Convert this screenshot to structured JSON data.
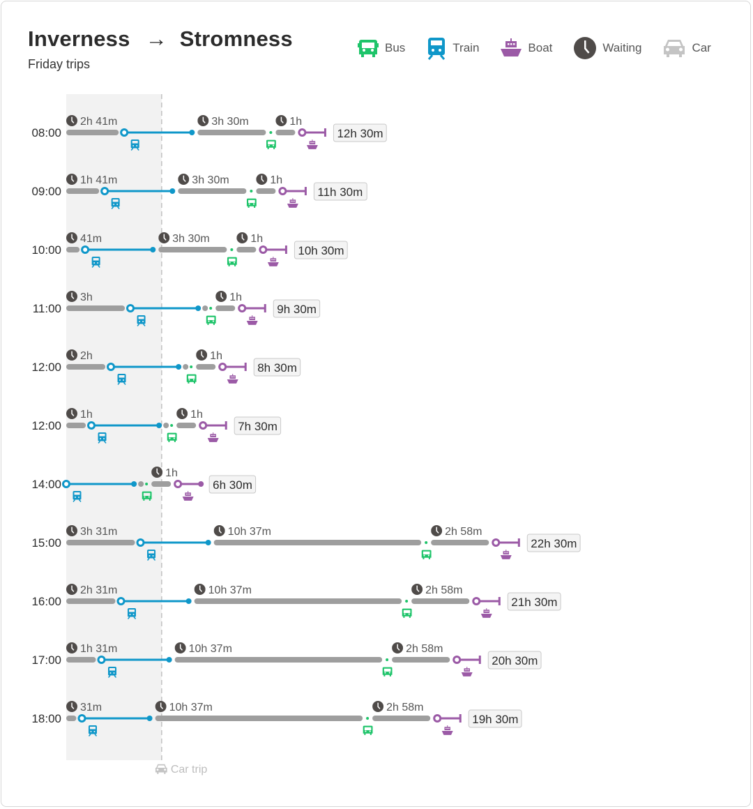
{
  "header": {
    "origin": "Inverness",
    "arrow": "→",
    "destination": "Stromness",
    "subtitle": "Friday trips"
  },
  "legend": [
    {
      "key": "bus",
      "label": "Bus",
      "icon": "bus-icon",
      "color": "#1ec46a"
    },
    {
      "key": "train",
      "label": "Train",
      "icon": "train-icon",
      "color": "#0f97c9"
    },
    {
      "key": "boat",
      "label": "Boat",
      "icon": "boat-icon",
      "color": "#9b5aa6"
    },
    {
      "key": "waiting",
      "label": "Waiting",
      "icon": "clock-icon",
      "color": "#4f4b49"
    },
    {
      "key": "car",
      "label": "Car",
      "icon": "car-icon",
      "color": "#c4c4c4"
    }
  ],
  "colors": {
    "wait": "#9e9e9e",
    "train": "#0f97c9",
    "bus": "#1ec46a",
    "boat": "#9b5aa6",
    "clock": "#4f4b49",
    "car_zone": "#f2f2f2",
    "car_line": "#c4c4c4"
  },
  "chart_data": {
    "type": "timeline",
    "title": "Inverness → Stromness",
    "subtitle": "Friday trips",
    "units": "minutes from departure",
    "car_trip": {
      "label": "Car trip",
      "duration_min": 293
    },
    "rows": [
      {
        "departure": "08:00",
        "total": "12h 30m",
        "segments": [
          {
            "type": "wait",
            "min": 161,
            "label": "2h 41m"
          },
          {
            "type": "train",
            "min": 208
          },
          {
            "type": "wait",
            "min": 210,
            "label": "3h 30m"
          },
          {
            "type": "bus"
          },
          {
            "type": "wait",
            "min": 60,
            "label": "1h"
          },
          {
            "type": "boat",
            "min": 75,
            "end": "bar"
          }
        ]
      },
      {
        "departure": "09:00",
        "total": "11h 30m",
        "segments": [
          {
            "type": "wait",
            "min": 101,
            "label": "1h 41m"
          },
          {
            "type": "train",
            "min": 208
          },
          {
            "type": "wait",
            "min": 210,
            "label": "3h 30m"
          },
          {
            "type": "bus"
          },
          {
            "type": "wait",
            "min": 60,
            "label": "1h"
          },
          {
            "type": "boat",
            "min": 75,
            "end": "bar"
          }
        ]
      },
      {
        "departure": "10:00",
        "total": "10h 30m",
        "segments": [
          {
            "type": "wait",
            "min": 41,
            "label": "41m"
          },
          {
            "type": "train",
            "min": 208
          },
          {
            "type": "wait",
            "min": 210,
            "label": "3h 30m"
          },
          {
            "type": "bus"
          },
          {
            "type": "wait",
            "min": 60,
            "label": "1h"
          },
          {
            "type": "boat",
            "min": 75,
            "end": "bar"
          }
        ]
      },
      {
        "departure": "11:00",
        "total": "9h 30m",
        "segments": [
          {
            "type": "wait",
            "min": 180,
            "label": "3h"
          },
          {
            "type": "train",
            "min": 208
          },
          {
            "type": "shortwait"
          },
          {
            "type": "bus"
          },
          {
            "type": "wait",
            "min": 60,
            "label": "1h"
          },
          {
            "type": "boat",
            "min": 75,
            "end": "bar"
          }
        ]
      },
      {
        "departure": "12:00",
        "total": "8h 30m",
        "segments": [
          {
            "type": "wait",
            "min": 120,
            "label": "2h"
          },
          {
            "type": "train",
            "min": 208
          },
          {
            "type": "shortwait"
          },
          {
            "type": "bus"
          },
          {
            "type": "wait",
            "min": 60,
            "label": "1h"
          },
          {
            "type": "boat",
            "min": 75,
            "end": "bar"
          }
        ]
      },
      {
        "departure": "12:00",
        "total": "7h 30m",
        "segments": [
          {
            "type": "wait",
            "min": 60,
            "label": "1h"
          },
          {
            "type": "train",
            "min": 208
          },
          {
            "type": "shortwait"
          },
          {
            "type": "bus"
          },
          {
            "type": "wait",
            "min": 60,
            "label": "1h"
          },
          {
            "type": "boat",
            "min": 75,
            "end": "bar"
          }
        ]
      },
      {
        "departure": "14:00",
        "total": "6h 30m",
        "segments": [
          {
            "type": "train",
            "min": 208
          },
          {
            "type": "shortwait"
          },
          {
            "type": "bus"
          },
          {
            "type": "wait",
            "min": 60,
            "label": "1h"
          },
          {
            "type": "boat",
            "min": 75,
            "end": "dot"
          }
        ]
      },
      {
        "departure": "15:00",
        "total": "22h 30m",
        "segments": [
          {
            "type": "wait",
            "min": 211,
            "label": "3h 31m"
          },
          {
            "type": "train",
            "min": 208
          },
          {
            "type": "wait",
            "min": 637,
            "label": "10h 37m"
          },
          {
            "type": "bus"
          },
          {
            "type": "wait",
            "min": 178,
            "label": "2h 58m"
          },
          {
            "type": "boat",
            "min": 75,
            "end": "bar"
          }
        ]
      },
      {
        "departure": "16:00",
        "total": "21h 30m",
        "segments": [
          {
            "type": "wait",
            "min": 151,
            "label": "2h 31m"
          },
          {
            "type": "train",
            "min": 208
          },
          {
            "type": "wait",
            "min": 637,
            "label": "10h 37m"
          },
          {
            "type": "bus"
          },
          {
            "type": "wait",
            "min": 178,
            "label": "2h 58m"
          },
          {
            "type": "boat",
            "min": 75,
            "end": "bar"
          }
        ]
      },
      {
        "departure": "17:00",
        "total": "20h 30m",
        "segments": [
          {
            "type": "wait",
            "min": 91,
            "label": "1h 31m"
          },
          {
            "type": "train",
            "min": 208
          },
          {
            "type": "wait",
            "min": 637,
            "label": "10h 37m"
          },
          {
            "type": "bus"
          },
          {
            "type": "wait",
            "min": 178,
            "label": "2h 58m"
          },
          {
            "type": "boat",
            "min": 75,
            "end": "bar"
          }
        ]
      },
      {
        "departure": "18:00",
        "total": "19h 30m",
        "segments": [
          {
            "type": "wait",
            "min": 31,
            "label": "31m"
          },
          {
            "type": "train",
            "min": 208
          },
          {
            "type": "wait",
            "min": 637,
            "label": "10h 37m"
          },
          {
            "type": "bus"
          },
          {
            "type": "wait",
            "min": 178,
            "label": "2h 58m"
          },
          {
            "type": "boat",
            "min": 75,
            "end": "bar"
          }
        ]
      }
    ]
  }
}
